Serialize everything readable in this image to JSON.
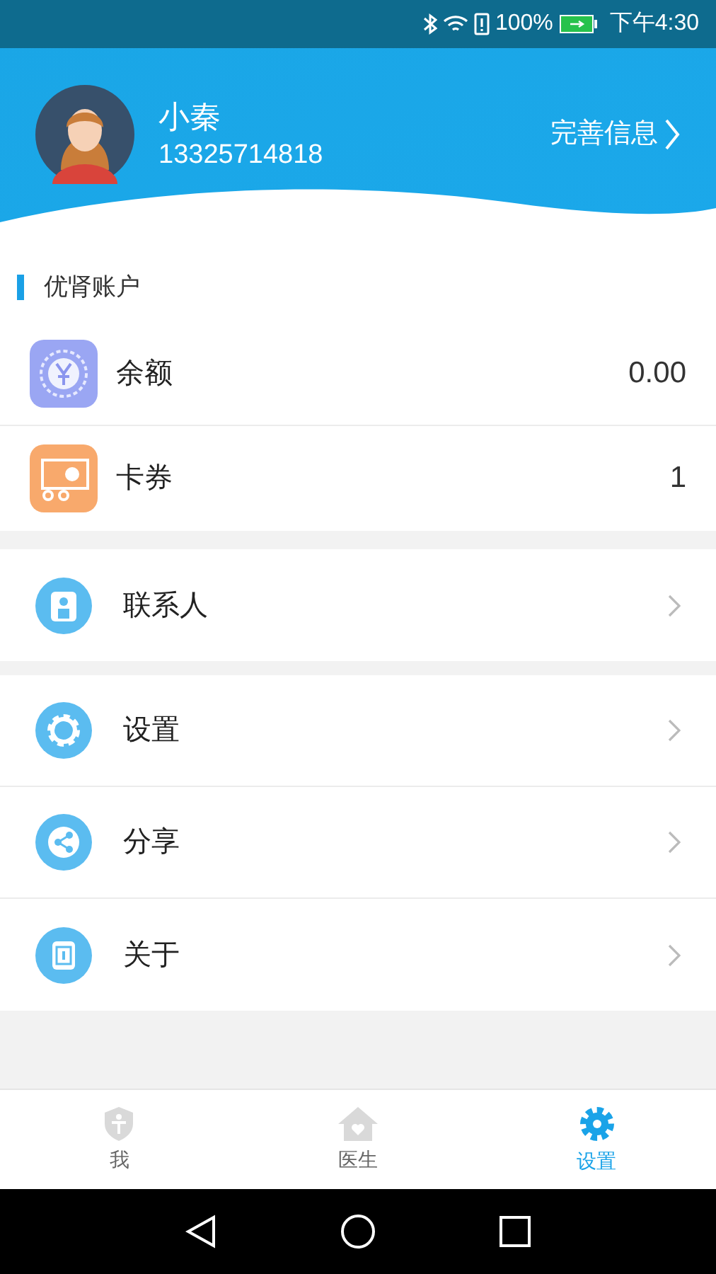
{
  "status_bar": {
    "battery": "100%",
    "time": "下午4:30"
  },
  "profile": {
    "name": "小秦",
    "phone": "13325714818",
    "action": "完善信息"
  },
  "account": {
    "title": "优肾账户",
    "items": [
      {
        "kind": "balance",
        "label": "余额",
        "value": "0.00"
      },
      {
        "kind": "coupon",
        "label": "卡券",
        "value": "1"
      }
    ]
  },
  "menu_groups": [
    [
      {
        "kind": "contacts",
        "label": "联系人"
      }
    ],
    [
      {
        "kind": "settings",
        "label": "设置"
      },
      {
        "kind": "share",
        "label": "分享"
      },
      {
        "kind": "about",
        "label": "关于"
      }
    ]
  ],
  "tabs": [
    {
      "kind": "me",
      "label": "我",
      "selected": false
    },
    {
      "kind": "doctor",
      "label": "医生",
      "selected": false
    },
    {
      "kind": "settings",
      "label": "设置",
      "selected": true
    }
  ]
}
